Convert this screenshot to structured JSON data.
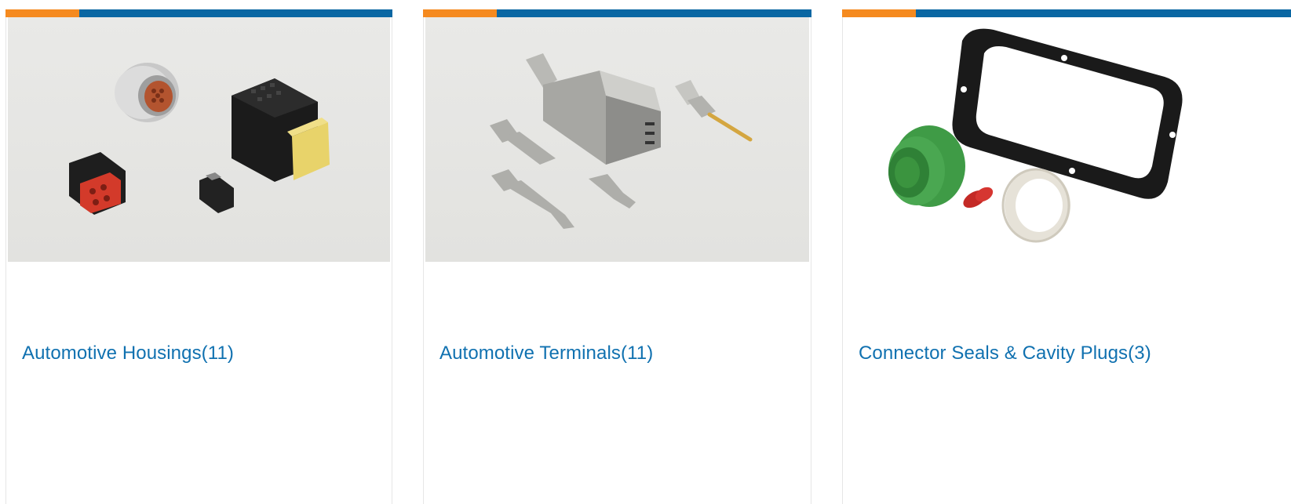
{
  "cards": [
    {
      "title": "Automotive Housings(11)",
      "image": "automotive-housings-image",
      "accent_colors": [
        "#f58a1f",
        "#0a67a3"
      ]
    },
    {
      "title": "Automotive Terminals(11)",
      "image": "automotive-terminals-image",
      "accent_colors": [
        "#f58a1f",
        "#0a67a3"
      ]
    },
    {
      "title": "Connector Seals & Cavity Plugs(3)",
      "image": "connector-seals-image",
      "accent_colors": [
        "#f58a1f",
        "#0a67a3"
      ]
    }
  ],
  "colors": {
    "link": "#1071b0",
    "accent_orange": "#f58a1f",
    "accent_blue": "#0a67a3"
  }
}
